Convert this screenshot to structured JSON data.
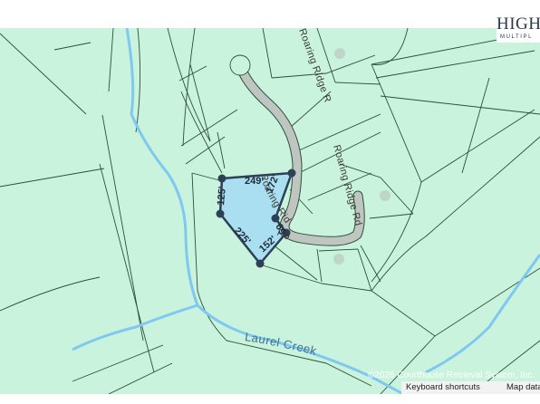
{
  "map": {
    "colors": {
      "land": "#c9f3dc",
      "parcel_line": "#2f4f3a",
      "road_fill": "#bfc5c1",
      "creek": "#7fc8ef",
      "selected_fill": "#a8ddf0",
      "selected_outline": "#2e3f58",
      "vertex": "#2e3f58"
    },
    "roads": [
      {
        "label": "Roaring Ridge Rd"
      },
      {
        "label": "Roaring Ridge Rd"
      },
      {
        "label": "Roaring Ridge Rd"
      },
      {
        "label": "Ro"
      }
    ],
    "creek_label": "Laurel Creek",
    "dimensions": [
      "249'",
      "172'",
      "125'",
      "225'",
      "152'",
      "69'"
    ],
    "copyright": "©2026 Courthouse Retrieval System, Inc.",
    "footer": {
      "keyboard_shortcuts": "Keyboard shortcuts",
      "map_data": "Map data ©"
    }
  },
  "logo": {
    "title": "HIGH",
    "subtitle": "MULTIPL"
  }
}
